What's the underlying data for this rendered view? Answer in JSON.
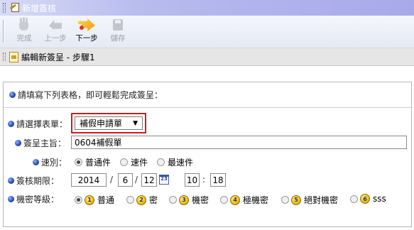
{
  "window": {
    "title": "新增簽核"
  },
  "toolbar": {
    "finish_label": "完成",
    "prev_label": "上一步",
    "next_label": "下一步",
    "save_label": "儲存"
  },
  "edit_header": {
    "title": "編輯新簽呈 - 步驟1"
  },
  "form": {
    "intro": "請填寫下列表格，即可輕鬆完成簽呈：",
    "form_select": {
      "label": "請選擇表單：",
      "value": "補假申請單"
    },
    "subject": {
      "label": "簽呈主旨：",
      "value": "0604補假單"
    },
    "speed": {
      "label": "速別：",
      "options": [
        {
          "label": "普通件",
          "selected": true
        },
        {
          "label": "速件",
          "selected": false
        },
        {
          "label": "最速件",
          "selected": false
        }
      ]
    },
    "deadline": {
      "label": "簽核期限：",
      "year": "2014",
      "month": "6",
      "day": "12",
      "calendar_icon_text": "23",
      "hour": "10",
      "minute": "18"
    },
    "security": {
      "label": "機密等級：",
      "options": [
        {
          "num": "1",
          "label": "普通",
          "selected": true
        },
        {
          "num": "2",
          "label": "密",
          "selected": false
        },
        {
          "num": "3",
          "label": "機密",
          "selected": false
        },
        {
          "num": "4",
          "label": "極機密",
          "selected": false
        },
        {
          "num": "5",
          "label": "絕對機密",
          "selected": false
        },
        {
          "num": "6",
          "label": "sss",
          "selected": false
        }
      ]
    }
  }
}
